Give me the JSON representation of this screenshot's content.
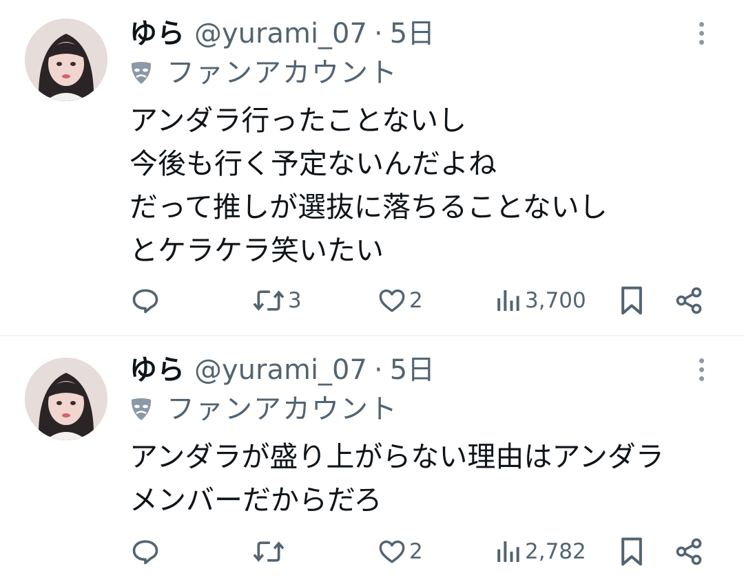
{
  "tweets": [
    {
      "name": "ゆら",
      "handle": "@yurami_07",
      "separator": "·",
      "time": "5日",
      "label": "ファンアカウント",
      "lines": [
        "アンダラ行ったことないし",
        "今後も行く予定ないんだよね",
        "だって推しが選抜に落ちることないし",
        "とケラケラ笑いたい"
      ],
      "retweets": "3",
      "likes": "2",
      "views": "3,700"
    },
    {
      "name": "ゆら",
      "handle": "@yurami_07",
      "separator": "·",
      "time": "5日",
      "label": "ファンアカウント",
      "lines": [
        "アンダラが盛り上がらない理由はアンダラ",
        "メンバーだからだろ"
      ],
      "retweets": "",
      "likes": "2",
      "views": "2,782"
    }
  ],
  "colors": {
    "text": "#0f1419",
    "secondary": "#536471",
    "divider": "#eff3f4"
  }
}
